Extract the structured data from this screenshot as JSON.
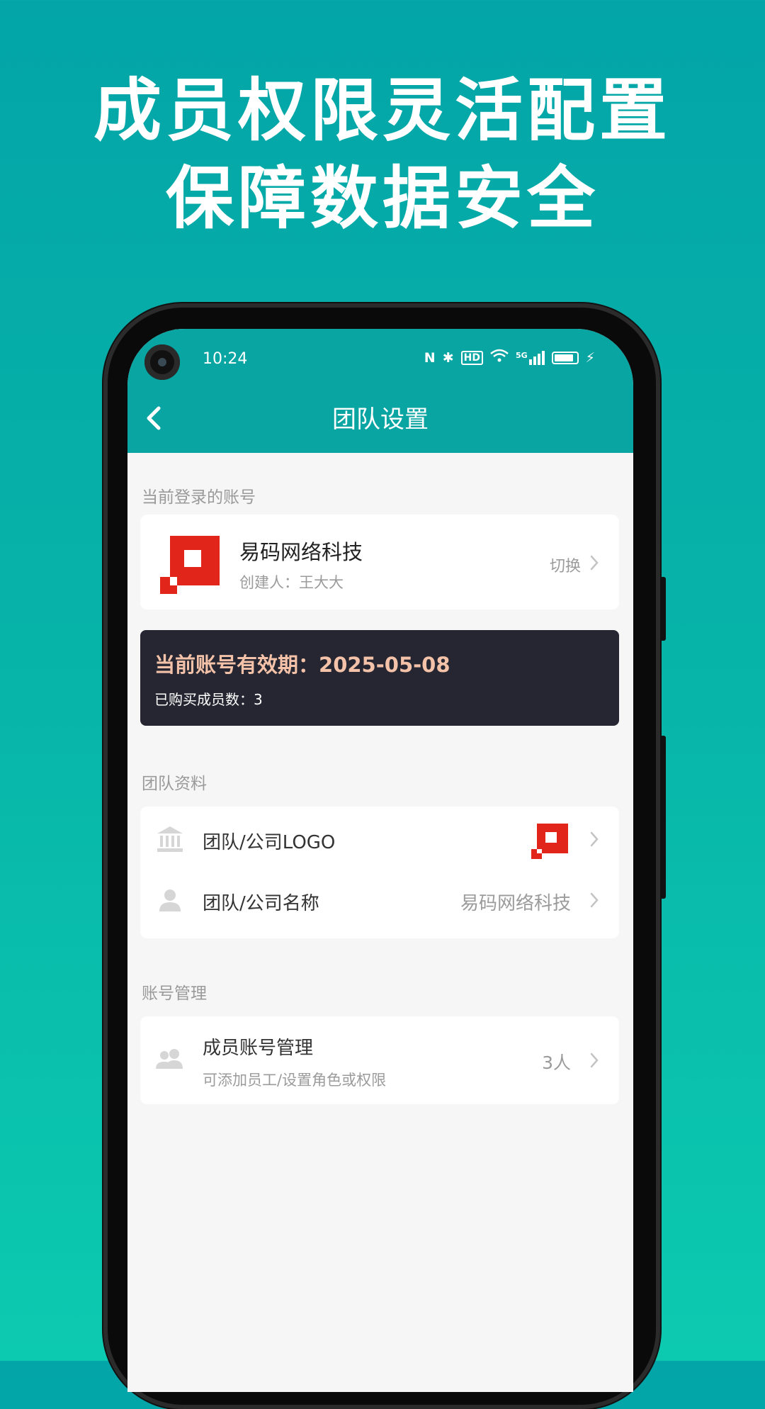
{
  "promo": {
    "line1": "成员权限灵活配置",
    "line2": "保障数据安全"
  },
  "status_bar": {
    "time": "10:24",
    "icons": [
      "nfc-icon",
      "bluetooth-icon",
      "hd-icon",
      "wifi-icon",
      "5g-signal-icon",
      "battery-icon",
      "charging-icon"
    ],
    "hd_label": "HD",
    "signal_label": "5G"
  },
  "nav": {
    "back_icon": "chevron-left-icon",
    "title": "团队设置"
  },
  "current_account": {
    "section_label": "当前登录的账号",
    "company_name": "易码网络科技",
    "creator": "创建人：王大大",
    "switch_label": "切换",
    "logo_color": "#e1251b"
  },
  "subscription": {
    "expiry_label": "当前账号有效期：",
    "expiry_date": "2025-05-08",
    "members_bought": "已购买成员数：3",
    "background_color": "#252631",
    "accent_color": "#f3c2a8"
  },
  "team_info": {
    "section_label": "团队资料",
    "logo_row_label": "团队/公司LOGO",
    "name_row_label": "团队/公司名称",
    "name_row_value": "易码网络科技"
  },
  "account_mgmt": {
    "section_label": "账号管理",
    "title": "成员账号管理",
    "subtitle": "可添加员工/设置角色或权限",
    "count": "3人"
  },
  "colors": {
    "primary": "#08a5a2",
    "brand_red": "#e1251b"
  }
}
